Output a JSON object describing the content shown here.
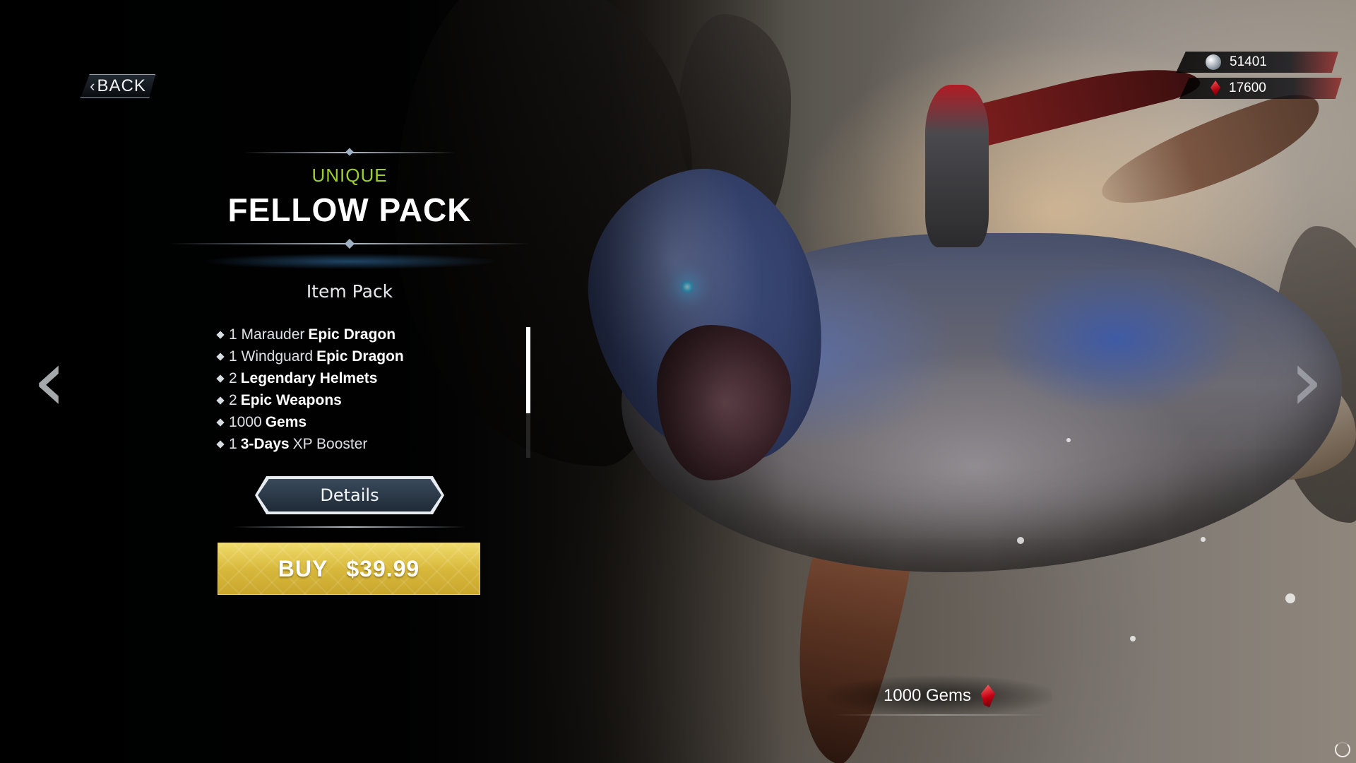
{
  "navigation": {
    "back_label": "BACK"
  },
  "currencies": [
    {
      "icon": "silver-coin-icon",
      "value": "51401"
    },
    {
      "icon": "red-gem-icon",
      "value": "17600"
    }
  ],
  "pack": {
    "rarity": "UNIQUE",
    "rarity_color": "#9ccf2c",
    "title": "FELLOW PACK",
    "type": "Item Pack",
    "items": [
      {
        "prefix": "1 Marauder",
        "highlight": "Epic Dragon",
        "suffix": ""
      },
      {
        "prefix": "1 Windguard",
        "highlight": "Epic Dragon",
        "suffix": ""
      },
      {
        "prefix": "2",
        "highlight": "Legendary Helmets",
        "suffix": ""
      },
      {
        "prefix": "2",
        "highlight": "Epic Weapons",
        "suffix": ""
      },
      {
        "prefix": "1000",
        "highlight": "Gems",
        "suffix": ""
      },
      {
        "prefix": "1",
        "highlight": "3-Days",
        "suffix": "XP Booster"
      }
    ],
    "details_label": "Details",
    "buy_label": "BUY",
    "price": "$39.99",
    "buy_color": "#d8b93c"
  },
  "reward_caption": {
    "text": "1000 Gems",
    "icon": "red-gem-icon"
  },
  "icons": {
    "prev": "chevron-left-icon",
    "next": "chevron-right-icon",
    "loading": "loading-icon"
  }
}
